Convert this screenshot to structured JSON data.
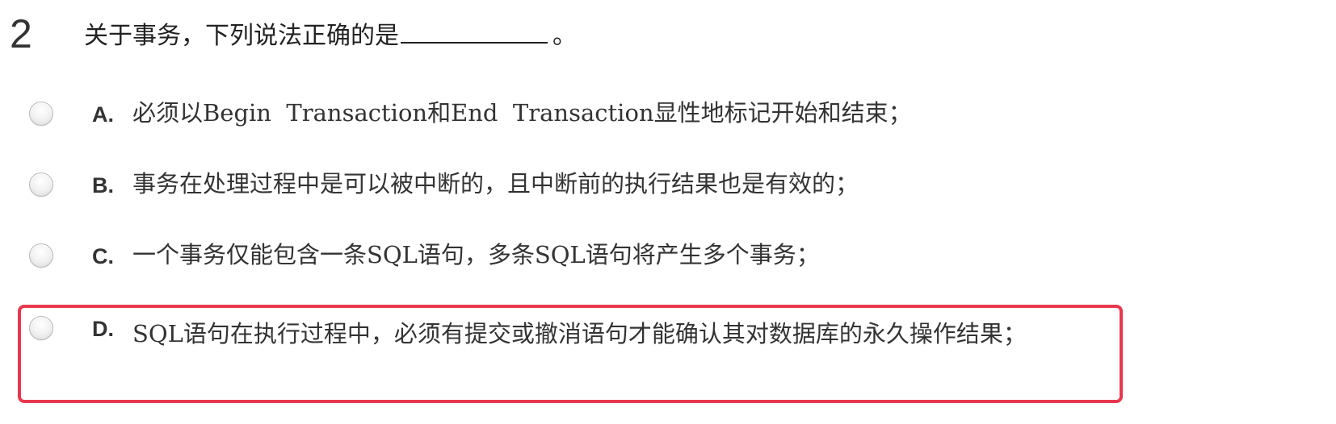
{
  "question": {
    "number": "2",
    "stem_before": "关于事务，下列说法正确的是",
    "stem_after": "。"
  },
  "options": [
    {
      "letter": "A.",
      "text": "必须以Begin  Transaction和End  Transaction显性地标记开始和结束；"
    },
    {
      "letter": "B.",
      "text": "事务在处理过程中是可以被中断的，且中断前的执行结果也是有效的；"
    },
    {
      "letter": "C.",
      "text": "一个事务仅能包含一条SQL语句，多条SQL语句将产生多个事务；"
    },
    {
      "letter": "D.",
      "text": "SQL语句在执行过程中，必须有提交或撤消语句才能确认其对数据库的永久操作结果；"
    }
  ],
  "colors": {
    "highlight_border": "#e8384f",
    "text": "#333333"
  }
}
